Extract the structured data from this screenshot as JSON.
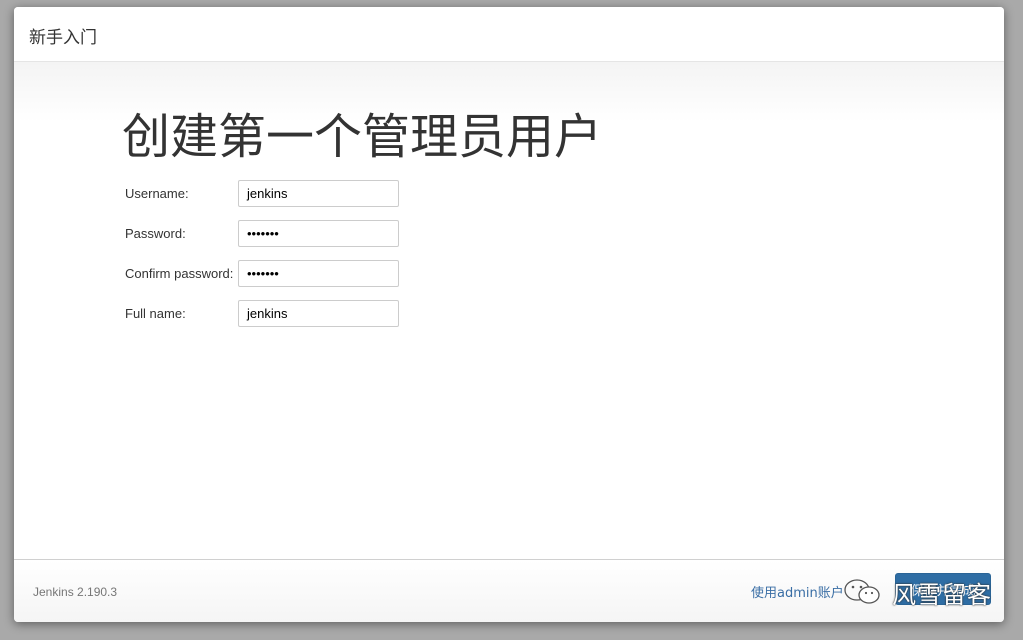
{
  "dialog": {
    "title": "新手入门"
  },
  "main": {
    "heading": "创建第一个管理员用户",
    "form": {
      "username_label": "Username:",
      "username_value": "jenkins",
      "password_label": "Password:",
      "password_value": "•••••••",
      "confirm_label": "Confirm password:",
      "confirm_value": "•••••••",
      "fullname_label": "Full name:",
      "fullname_value": "jenkins"
    }
  },
  "footer": {
    "version": "Jenkins 2.190.3",
    "skip_link": "使用admin账户",
    "save_button": "保存并完成"
  },
  "watermark": {
    "text": "风雪留客",
    "icon": "wechat-icon"
  },
  "colors": {
    "accent": "#2e6da4",
    "link": "#3a6ea5",
    "backdrop": "#a9a9a9"
  }
}
